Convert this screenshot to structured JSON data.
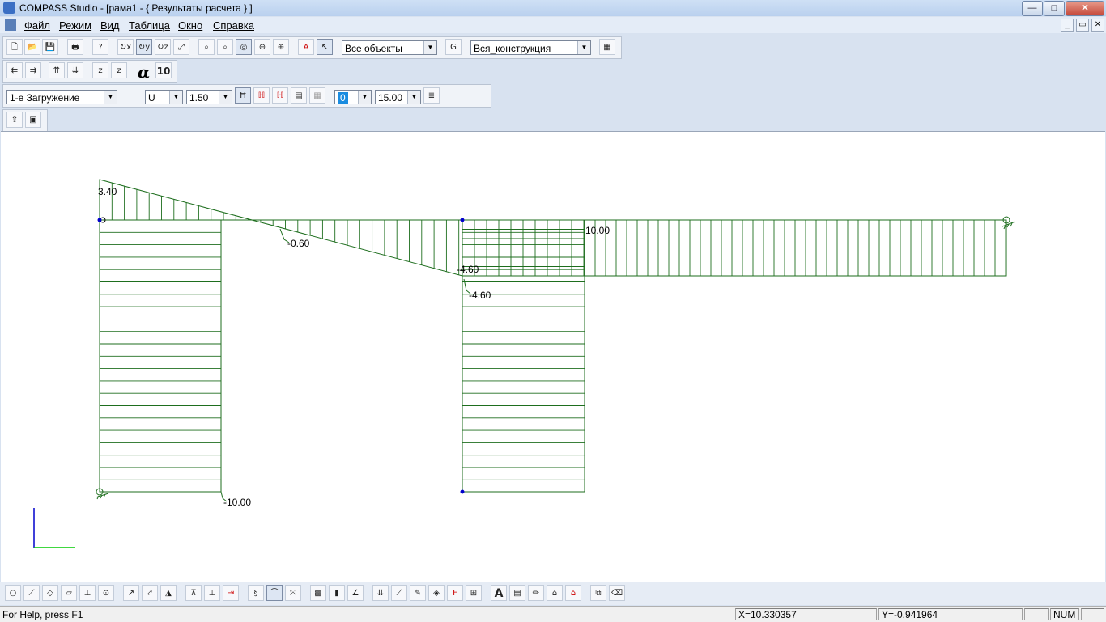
{
  "window": {
    "title": "COMPASS  Studio - [рама1 - { Результаты расчета } ]",
    "minimize": "—",
    "maximize": "□",
    "close": "✕",
    "doc_minimize": "_",
    "doc_restore": "▭",
    "doc_close": "✕"
  },
  "menu": [
    "Файл",
    "Режим",
    "Вид",
    "Таблица",
    "Окно",
    "Справка"
  ],
  "toolbar1": {
    "objects_filter": "Все объекты",
    "construction": "Вся_конструкция"
  },
  "toolbar2": {
    "alpha_symbol": "α",
    "font_size": "10"
  },
  "toolbar3": {
    "load_case": "1-е Загружение",
    "component": "U",
    "scale": "1.50",
    "color_value": "0",
    "size_value": "15.00"
  },
  "diagram": {
    "labels": [
      "3.40",
      "-0.60",
      "-4.60",
      "-4.60",
      "10.00",
      "-10.00"
    ],
    "line_color": "#1e6e1e",
    "node_color": "#0000cc"
  },
  "status": {
    "help": "For Help, press F1",
    "x_coord": "X=10.330357",
    "y_coord": "Y=-0.941964",
    "num": "NUM"
  }
}
